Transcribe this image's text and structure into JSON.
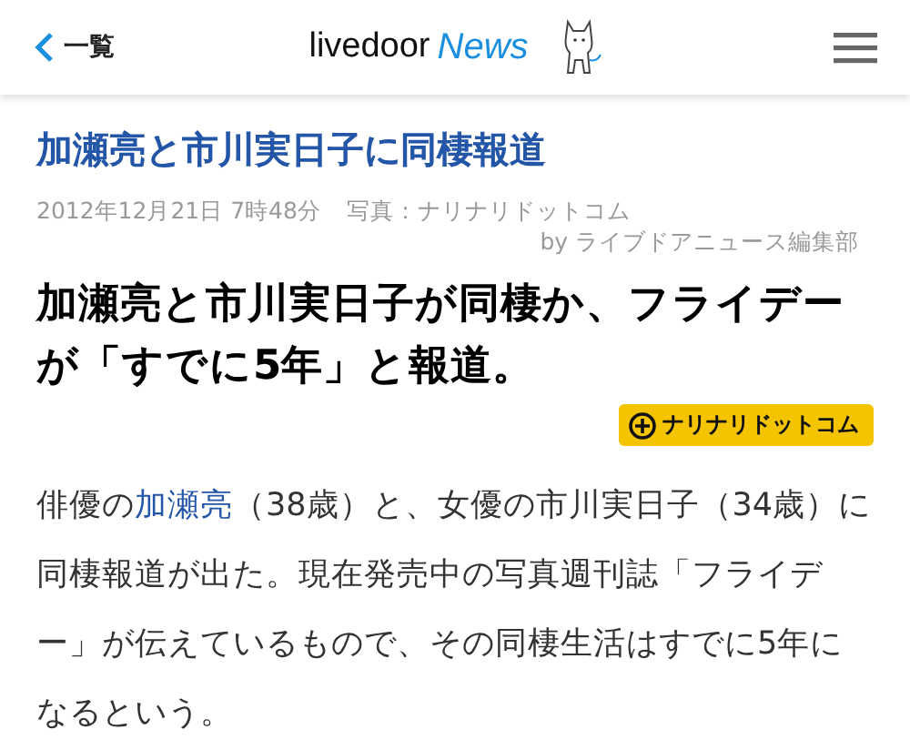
{
  "header": {
    "back_label": "一覧",
    "logo": {
      "brand": "livedoor",
      "product": "News"
    }
  },
  "article": {
    "title": "加瀬亮と市川実日子に同棲報道",
    "date": "2012年12月21日 7時48分",
    "photo_credit": "写真：ナリナリドットコム",
    "byline": "by ライブドアニュース編集部",
    "headline": "加瀬亮と市川実日子が同棲か、フライデーが「すでに5年」と報道。",
    "source_badge": "ナリナリドットコム",
    "body": {
      "before": "俳優の",
      "link": "加瀬亮",
      "after": "（38歳）と、女優の市川実日子（34歳）に同棲報道が出た。現在発売中の写真週刊誌「フライデー」が伝えているもので、その同棲生活はすでに5年になるという。"
    }
  }
}
